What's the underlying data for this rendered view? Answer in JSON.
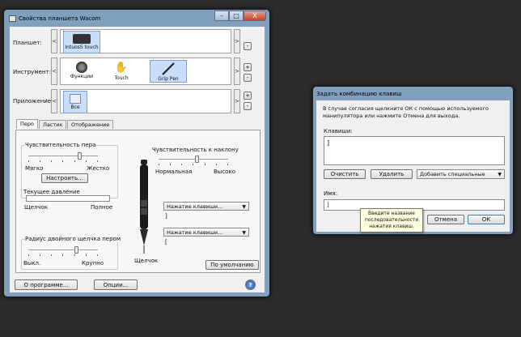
{
  "wacom": {
    "title": "Свойства планшета Wacom",
    "caption": {
      "min": "–",
      "max": "□",
      "close": "X"
    },
    "rows": {
      "tablet_label": "Планшет:",
      "tool_label": "Инструмент:",
      "app_label": "Приложение:"
    },
    "tablet_items": [
      "Intuos5 touch"
    ],
    "tool_items": [
      "Функции",
      "Touch",
      "Grip Pen"
    ],
    "app_items": [
      "Все"
    ],
    "side_buttons": {
      "minus": "-",
      "plus": "+"
    },
    "tabs": [
      "Перо",
      "Ластик",
      "Отображение"
    ],
    "pen": {
      "sensitivity_label": "Чувствительность пера",
      "soft": "Мягко",
      "firm": "Жестко",
      "customize": "Настроить...",
      "current_pressure": "Текущее давление",
      "click": "Щелчок",
      "full": "Полное",
      "tilt_label": "Чувствительность к наклону",
      "normal": "Нормальная",
      "high": "Высоко",
      "double_click_label": "Радиус двойного щелчка пером",
      "off": "Выкл.",
      "large": "Крупно",
      "pen_click": "Щелчок",
      "upper_button": "Нажатие клавиши...",
      "lower_button": "Нажатие клавиши...",
      "upper_value": "]",
      "lower_value": "[",
      "defaults": "По умолчанию",
      "sensitivity_level": 0.75,
      "tilt_level": 0.55,
      "double_click_level": 0.7
    },
    "about": "О программе...",
    "options": "Опции...",
    "help": "?"
  },
  "keys": {
    "title": "Задать комбинацию клавиш",
    "instructions": "В случае согласия щелкните ОК с помощью используемого манипулятора или нажмите Отмена для выхода.",
    "keys_label": "Клавиши:",
    "keys_value": "]",
    "clear": "Очистить",
    "delete": "Удалить",
    "add_special": "Добавить специальные",
    "name_label": "Имя:",
    "name_value": "]",
    "tooltip": "Введите название последовательности нажатия клавиш.",
    "cancel": "Отмена",
    "ok": "ОК"
  }
}
